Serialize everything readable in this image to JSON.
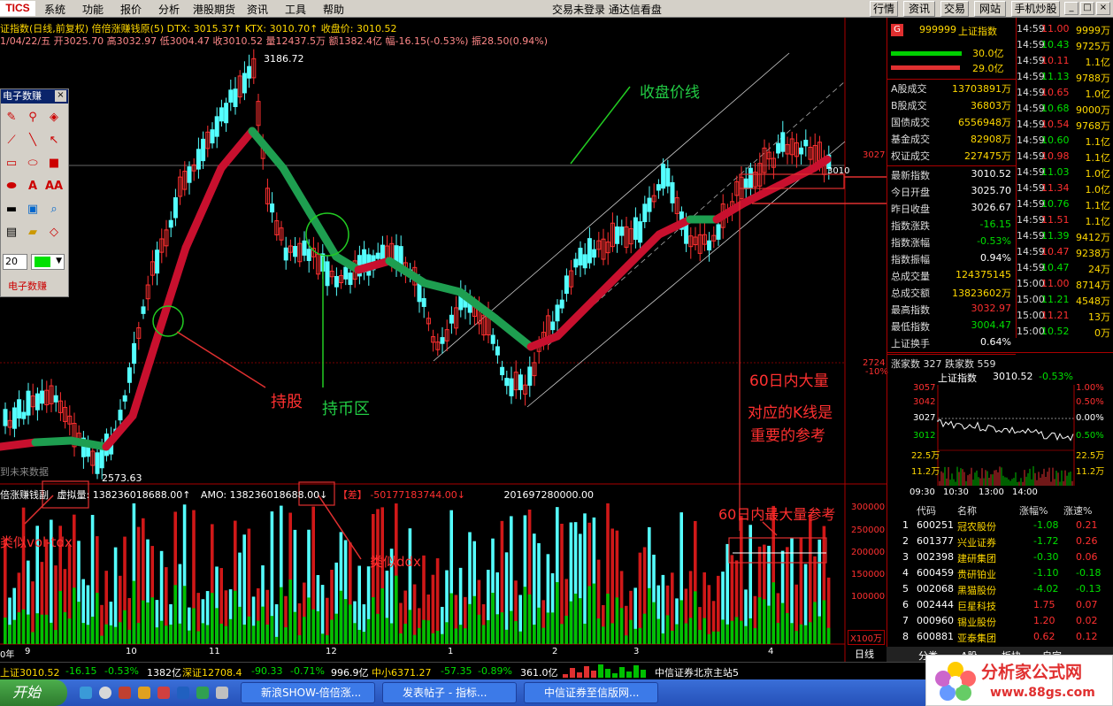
{
  "menubar": {
    "logo": "TICS",
    "items": [
      "系统",
      "功能",
      "报价",
      "分析",
      "港股期货",
      "资讯",
      "工具",
      "帮助"
    ],
    "app_title": "交易未登录  通达信看盘",
    "right_buttons": [
      "行情",
      "资讯",
      "交易",
      "网站",
      "手机炒股"
    ]
  },
  "header": {
    "line1": "证指数(日线,前复权) 倍倍涨赚钱原(5)  DTX: 3015.37↑ KTX: 3010.70↑  收盘价: 3010.52",
    "line2": "1/04/22/五 开3025.70 高3032.97 低3004.47 收3010.52 量12437.5万 额1382.4亿 幅-16.15(-0.53%) 振28.50(0.94%)"
  },
  "chart_labels": {
    "high": "3186.72",
    "low": "2573.63",
    "price_3027": "3027",
    "price_2724": "2724",
    "pct_10": "-10%",
    "last": "3010",
    "future": "到未来数据"
  },
  "annotations": {
    "close_line": "收盘价线",
    "hold": "持股",
    "cash": "持币区",
    "big60": "60日内大量",
    "kline": "对应的K线是",
    "ref": "重要的参考",
    "max60": "60日内最大量参考",
    "vol_tdx": "类似vol-tdx",
    "ddx": "类似ddx"
  },
  "vol_header": {
    "name": "倍涨赚钱副",
    "virt": "虚拟量:",
    "virt_val": "138236018688.00↑",
    "amo": "AMO: 138236018688.00↓",
    "diff": "【差】",
    "diff_val": "-50177183744.00↓",
    "other": "201697280000.00"
  },
  "vol_axis": [
    "300000",
    "250000",
    "200000",
    "150000",
    "100000",
    "X100万"
  ],
  "x_axis": [
    "0年",
    "9",
    "10",
    "11",
    "12",
    "1",
    "2",
    "3",
    "4"
  ],
  "period": "日线",
  "tools": {
    "title": "电子数赚",
    "footer": "电子数赚",
    "width_value": "20"
  },
  "quote": {
    "code": "999999",
    "name": "上证指数",
    "buy": "30.0亿",
    "sell": "29.0亿",
    "rows1": [
      [
        "A股成交",
        "13703891万"
      ],
      [
        "B股成交",
        "36803万"
      ],
      [
        "国债成交",
        "6556948万"
      ],
      [
        "基金成交",
        "82908万"
      ],
      [
        "权证成交",
        "227475万"
      ]
    ],
    "rows2": [
      [
        "最新指数",
        "3010.52"
      ],
      [
        "今日开盘",
        "3025.70"
      ],
      [
        "昨日收盘",
        "3026.67"
      ],
      [
        "指数涨跌",
        "-16.15"
      ],
      [
        "指数涨幅",
        "-0.53%"
      ],
      [
        "指数振幅",
        "0.94%"
      ],
      [
        "总成交量",
        "124375145"
      ],
      [
        "总成交额",
        "13823602万"
      ],
      [
        "最高指数",
        "3032.97"
      ],
      [
        "最低指数",
        "3004.47"
      ],
      [
        "上证换手",
        "0.64%"
      ]
    ],
    "updown": "涨家数  327  跌家数   559"
  },
  "mini": {
    "title": "上证指数",
    "last": "3010.52",
    "pct": "-0.53%",
    "left": [
      "3057",
      "3042",
      "3027",
      "3012",
      "22.5万",
      "11.2万"
    ],
    "right": [
      "1.00%",
      "0.50%",
      "0.00%",
      "0.50%",
      "22.5万",
      "11.2万"
    ],
    "times": [
      "09:30",
      "10:30",
      "13:00",
      "14:00"
    ]
  },
  "ticks": [
    [
      "14:59",
      "11.00",
      "9999万"
    ],
    [
      "14:59",
      "10.43",
      "9725万"
    ],
    [
      "14:59",
      "10.11",
      "1.1亿"
    ],
    [
      "14:59",
      "11.13",
      "9788万"
    ],
    [
      "14:59",
      "10.65",
      "1.0亿"
    ],
    [
      "14:59",
      "10.68",
      "9000万"
    ],
    [
      "14:59",
      "10.54",
      "9768万"
    ],
    [
      "14:59",
      "10.60",
      "1.1亿"
    ],
    [
      "14:59",
      "10.98",
      "1.1亿"
    ],
    [
      "14:59",
      "11.03",
      "1.0亿"
    ],
    [
      "14:59",
      "11.34",
      "1.0亿"
    ],
    [
      "14:59",
      "10.76",
      "1.1亿"
    ],
    [
      "14:59",
      "11.51",
      "1.1亿"
    ],
    [
      "14:59",
      "11.39",
      "9412万"
    ],
    [
      "14:59",
      "10.47",
      "9238万"
    ],
    [
      "14:59",
      "10.47",
      "24万"
    ],
    [
      "15:00",
      "11.00",
      "8714万"
    ],
    [
      "15:00",
      "11.21",
      "4548万"
    ],
    [
      "15:00",
      "11.21",
      "13万"
    ],
    [
      "15:00",
      "10.52",
      "0万"
    ]
  ],
  "rank": {
    "headers": [
      "代码",
      "名称",
      "涨幅%",
      "涨速%"
    ],
    "rows": [
      [
        "1",
        "600251",
        "冠农股份",
        "-1.08",
        "0.21"
      ],
      [
        "2",
        "601377",
        "兴业证券",
        "-1.72",
        "0.26"
      ],
      [
        "3",
        "002398",
        "建研集团",
        "-0.30",
        "0.06"
      ],
      [
        "4",
        "600459",
        "贵研铂业",
        "-1.10",
        "-0.18"
      ],
      [
        "5",
        "002068",
        "黑猫股份",
        "-4.02",
        "-0.13"
      ],
      [
        "6",
        "002444",
        "巨星科技",
        "1.75",
        "0.07"
      ],
      [
        "7",
        "000960",
        "锡业股份",
        "1.20",
        "0.02"
      ],
      [
        "8",
        "600881",
        "亚泰集团",
        "0.62",
        "0.12"
      ]
    ]
  },
  "bottom_tabs": [
    "分类",
    "A股",
    "板块",
    "自定"
  ],
  "status": {
    "sh": "上证3010.52",
    "sh_ch": "-16.15",
    "sh_pct": "-0.53%",
    "sh_amt": "1382亿",
    "sz": "深证12708.4",
    "sz_ch": "-90.33",
    "sz_pct": "-0.71%",
    "sz_amt": "996.9亿",
    "zx": "中小6371.27",
    "zx_ch": "-57.35",
    "zx_pct": "-0.89%",
    "zx_amt": "361.0亿",
    "server": "中信证券北京主站5"
  },
  "taskbar": {
    "start": "开始",
    "tasks": [
      "新浪SHOW-倍倍涨...",
      "发表帖子 - 指标...",
      "中信证券至信版网..."
    ]
  },
  "watermark": {
    "name": "分析家公式网",
    "url": "www.88gs.com"
  },
  "colors": {
    "up": "#ff3030",
    "down": "#54ffff",
    "ma_up": "#c8102e",
    "ma_down": "#1e9e50"
  }
}
